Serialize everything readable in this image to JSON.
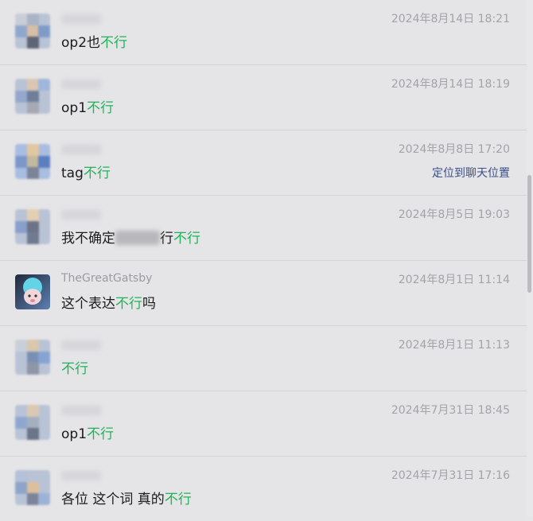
{
  "messages": [
    {
      "sender": "",
      "time": "2024年8月14日 18:21",
      "text_before": "op2也",
      "highlight": "不行",
      "text_after": "",
      "link": ""
    },
    {
      "sender": "",
      "time": "2024年8月14日 18:19",
      "text_before": "op1",
      "highlight": "不行",
      "text_after": "",
      "link": ""
    },
    {
      "sender": "",
      "time": "2024年8月8日 17:20",
      "text_before": "tag",
      "highlight": "不行",
      "text_after": "",
      "link": "定位到聊天位置"
    },
    {
      "sender": "",
      "time": "2024年8月5日 19:03",
      "text_before": "我不确定",
      "highlight": "不行",
      "text_after": "",
      "mid": "行",
      "link": ""
    },
    {
      "sender": "TheGreatGatsby",
      "time": "2024年8月1日 11:14",
      "text_before": "这个表达",
      "highlight": "不行",
      "text_after": "吗",
      "link": ""
    },
    {
      "sender": "",
      "time": "2024年8月1日 11:13",
      "text_before": "",
      "highlight": "不行",
      "text_after": "",
      "link": ""
    },
    {
      "sender": "",
      "time": "2024年7月31日 18:45",
      "text_before": "op1",
      "highlight": "不行",
      "text_after": "",
      "link": ""
    },
    {
      "sender": "",
      "time": "2024年7月31日 17:16",
      "text_before": "各位 这个词 真的",
      "highlight": "不行",
      "text_after": "",
      "link": ""
    }
  ],
  "colors": {
    "highlight": "#22b35a",
    "link": "#3a4f8a",
    "background": "#e5e5e7"
  }
}
